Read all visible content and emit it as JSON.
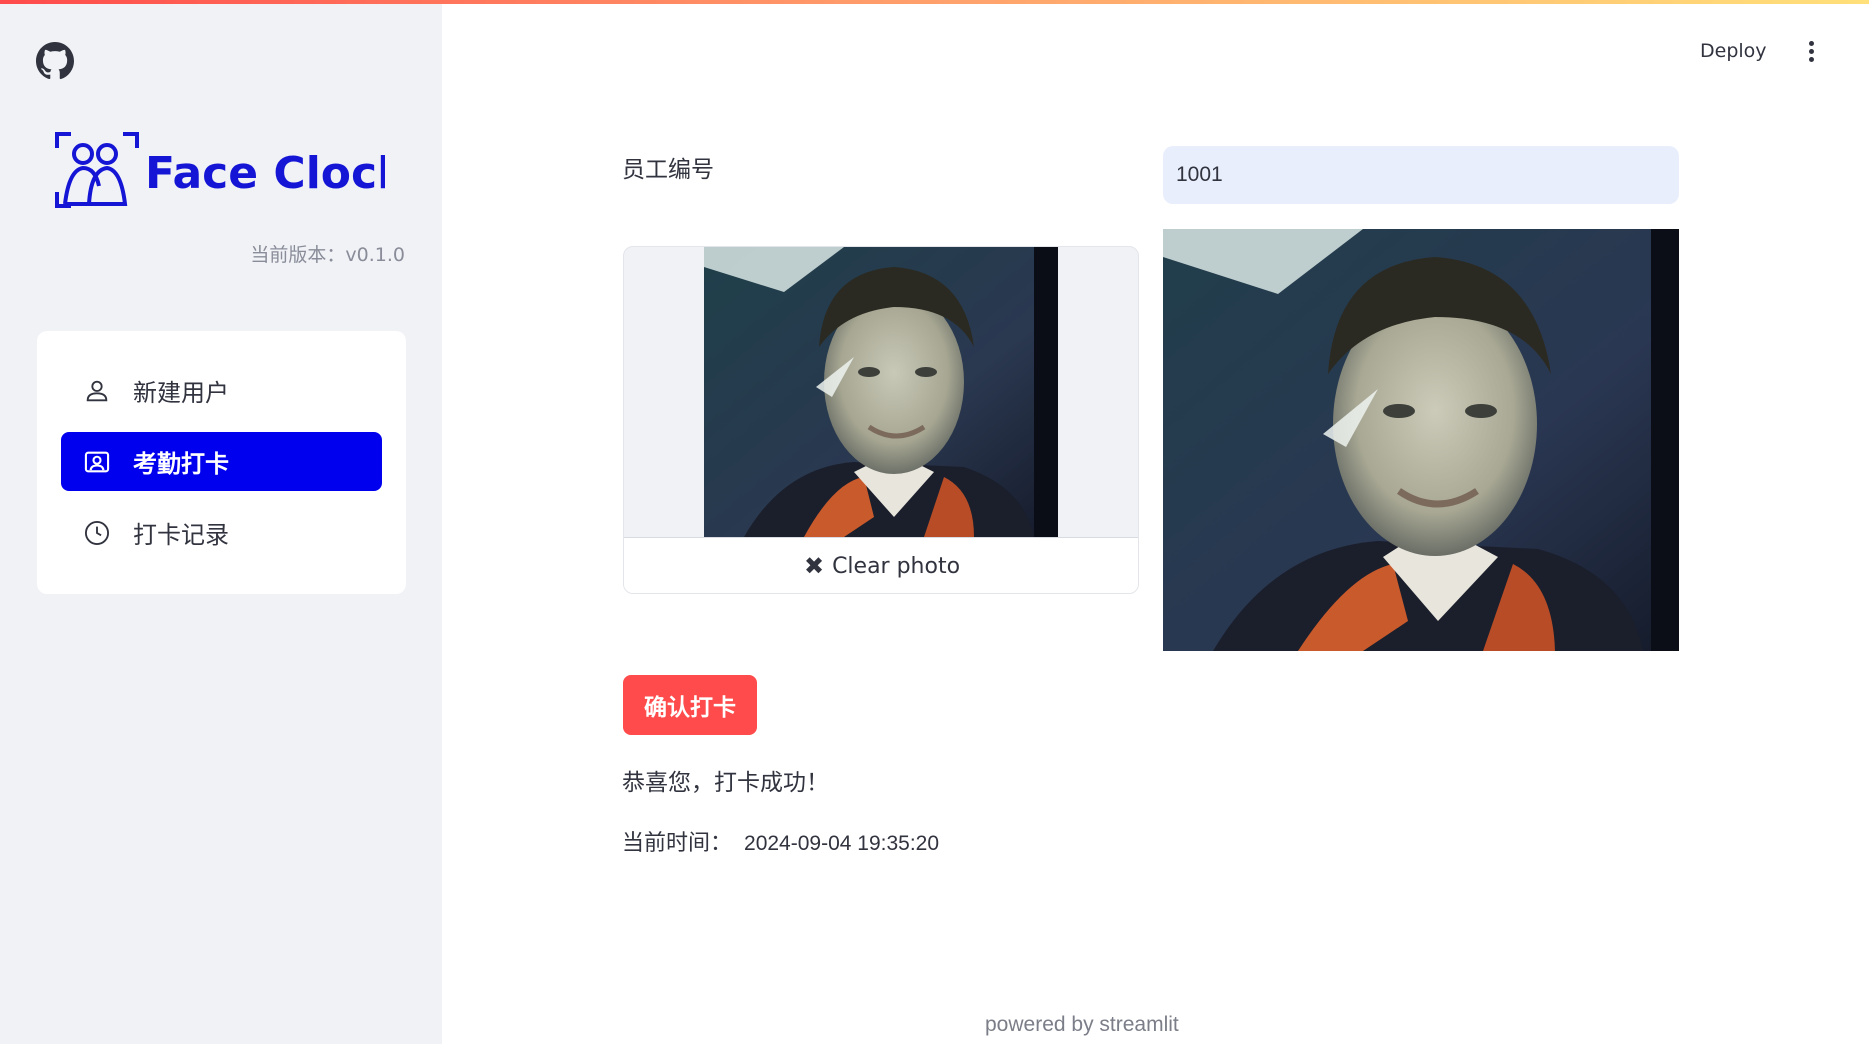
{
  "sidebar": {
    "logo_text": "Face Clock In",
    "version": "当前版本：v0.1.0",
    "menu": [
      {
        "label": "新建用户",
        "icon": "user-icon",
        "active": false
      },
      {
        "label": "考勤打卡",
        "icon": "portrait-icon",
        "active": true
      },
      {
        "label": "打卡记录",
        "icon": "clock-icon",
        "active": false
      }
    ]
  },
  "header": {
    "deploy_label": "Deploy",
    "menu_icon": "kebab-menu-icon"
  },
  "main": {
    "employee_id_label": "员工编号",
    "employee_id_value": "1001",
    "clear_photo_label": "Clear photo",
    "confirm_label": "确认打卡",
    "success_message": "恭喜您，打卡成功！",
    "time_label": "当前时间：",
    "time_value": "2024-09-04 19:35:20"
  },
  "footer": {
    "text": "powered by streamlit"
  },
  "colors": {
    "accent_blue": "#0000ee",
    "primary_red": "#ff4b4b",
    "sidebar_bg": "#f0f2f6",
    "input_bg": "#e8eefb"
  }
}
